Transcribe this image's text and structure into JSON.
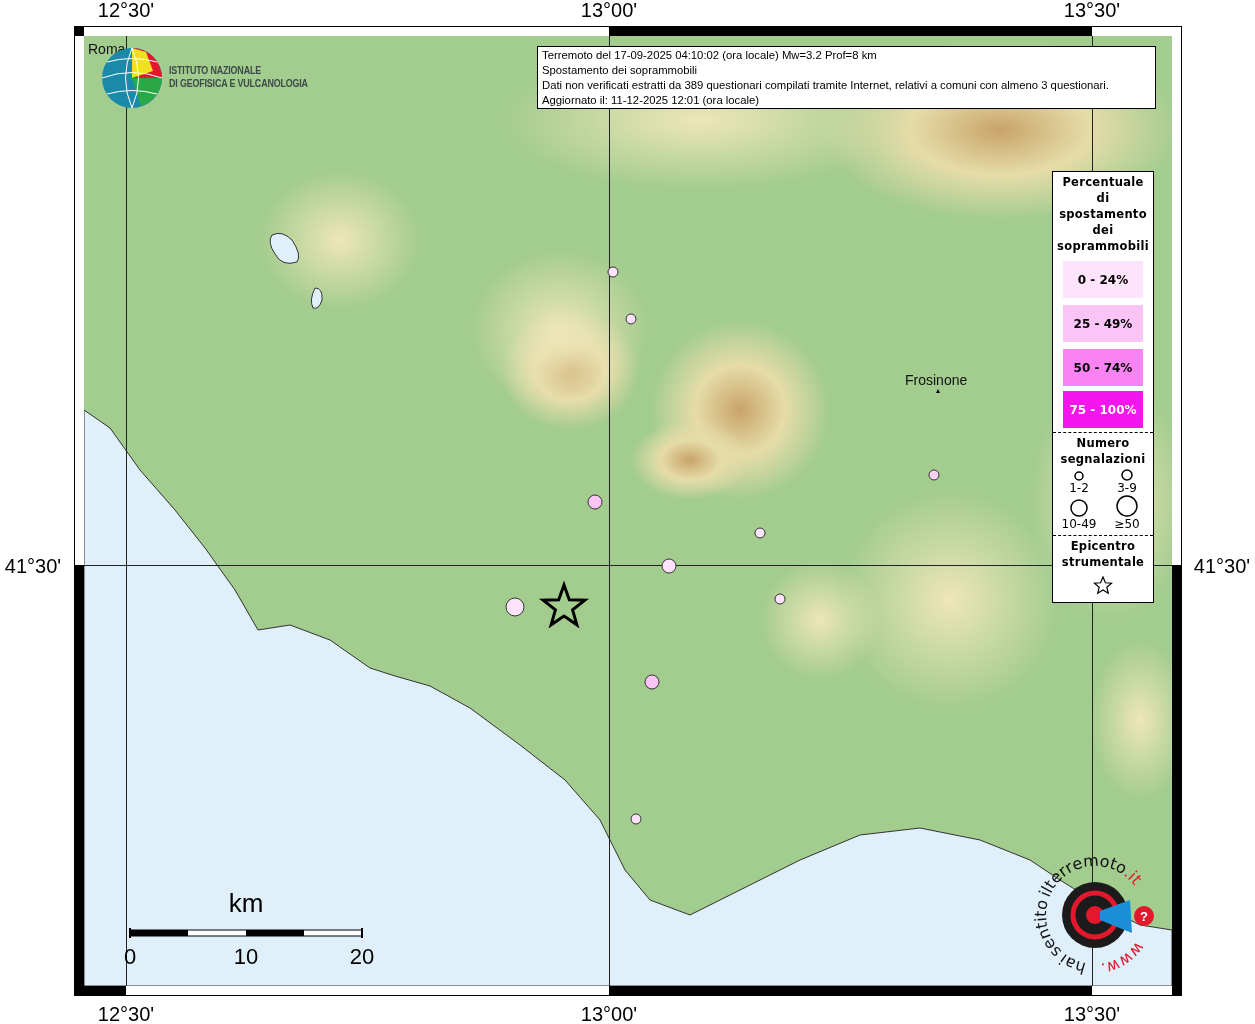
{
  "header": {
    "lines": [
      "Terremoto del 17-09-2025 04:10:02 (ora locale) Mw=3.2 Prof=8 km",
      "Spostamento dei soprammobili",
      "Dati non verificati estratti da 389 questionari compilati tramite Internet, relativi a comuni con almeno 3 questionari.",
      "Aggiornato il: 11-12-2025 12:01 (ora locale)"
    ]
  },
  "logo": {
    "lines": [
      "ISTITUTO NAZIONALE",
      "DI GEOFISICA E VULCANOLOGIA"
    ]
  },
  "axes": {
    "top": [
      "12°30'",
      "13°00'",
      "13°30'"
    ],
    "bottom": [
      "12°30'",
      "13°00'",
      "13°30'"
    ],
    "left": [
      "41°30'"
    ],
    "right": [
      "41°30'"
    ]
  },
  "places": [
    {
      "name": "Roma"
    },
    {
      "name": "Frosinone"
    }
  ],
  "legend": {
    "title_lines": [
      "Percentuale",
      "di",
      "spostamento",
      "dei",
      "soprammobili"
    ],
    "classes": [
      {
        "label": "0 - 24%",
        "color": "#fde3fb"
      },
      {
        "label": "25 - 49%",
        "color": "#fbc4f7"
      },
      {
        "label": "50 - 74%",
        "color": "#f983f3"
      },
      {
        "label": "75 - 100%",
        "color": "#f515ee"
      }
    ],
    "count_title_lines": [
      "Numero",
      "segnalazioni"
    ],
    "sizes": [
      {
        "label": "1-2"
      },
      {
        "label": "3-9"
      },
      {
        "label": "10-49"
      },
      {
        "label": "≥50"
      }
    ],
    "epicenter_title_lines": [
      "Epicentro",
      "strumentale"
    ]
  },
  "markers": [
    {
      "color": "#fde3fb",
      "kind": "small"
    },
    {
      "color": "#fde3fb",
      "kind": "small"
    },
    {
      "color": "#fbc4f7",
      "kind": "medium"
    },
    {
      "color": "#fbd2f8",
      "kind": "small"
    },
    {
      "color": "#fde3fb",
      "kind": "small"
    },
    {
      "color": "#fde3fb",
      "kind": "medium"
    },
    {
      "color": "#fde3fb",
      "kind": "small"
    },
    {
      "color": "#fde3fb",
      "kind": "large"
    },
    {
      "color": "#fbc4f7",
      "kind": "medium"
    },
    {
      "color": "#fde3fb",
      "kind": "small"
    }
  ],
  "scale": {
    "unit": "km",
    "ticks": [
      "0",
      "10",
      "20"
    ]
  },
  "site_logo": {
    "parts": [
      {
        "text": "terremoto",
        "kind": "plain"
      },
      {
        "text": ".it",
        "kind": "accent"
      },
      {
        "text": "hai sentito il",
        "kind": "plain"
      },
      {
        "text": "www.",
        "kind": "accent"
      }
    ],
    "badge": "?"
  }
}
